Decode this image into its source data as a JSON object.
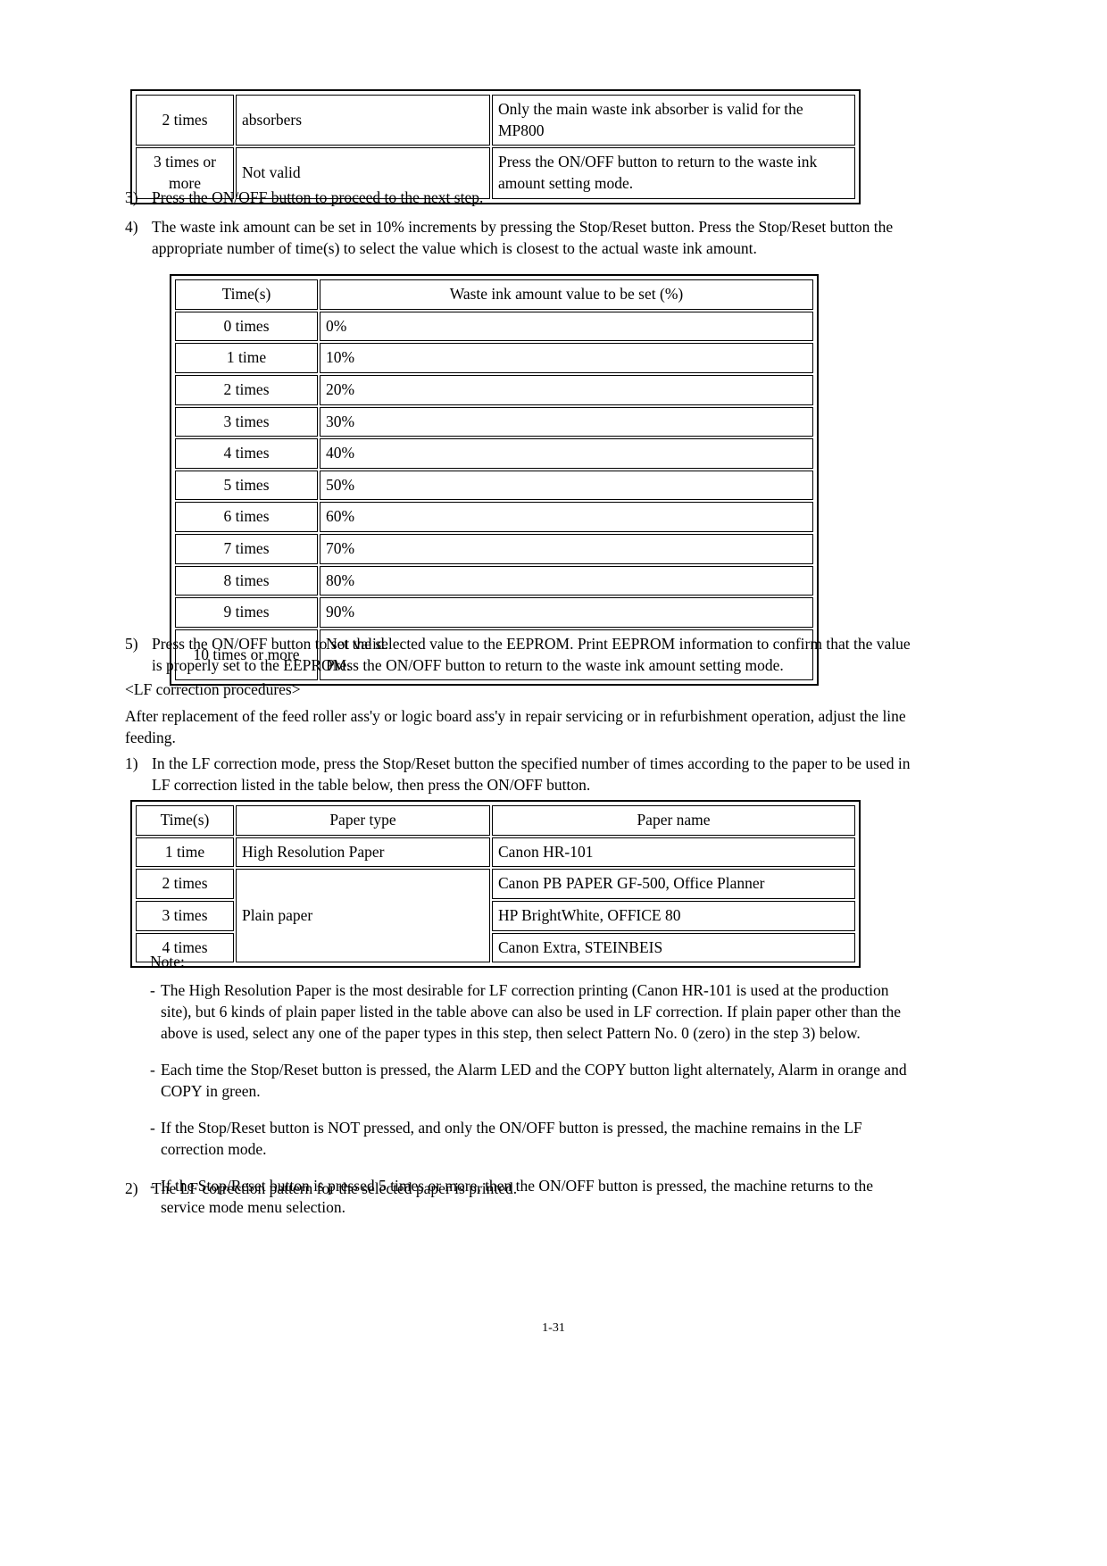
{
  "document": {
    "page_number": "1-31"
  },
  "top_table": {
    "rows": [
      {
        "times": "2 times",
        "validity": "absorbers",
        "description": "Only the main waste ink absorber is valid for the MP800"
      },
      {
        "times": "3 times or more",
        "validity": "Not valid",
        "description": "Press the ON/OFF button to return to the waste ink amount setting mode."
      }
    ]
  },
  "steps": {
    "step3": {
      "num": "3)",
      "text": "Press the ON/OFF button to proceed to the next step."
    },
    "step4": {
      "num": "4)",
      "text": "The waste ink amount can be set in 10% increments by pressing the Stop/Reset button. Press the Stop/Reset button the appropriate number of time(s) to select the value which is closest to the actual waste ink amount."
    },
    "step5": {
      "num": "5)",
      "text": "Press the ON/OFF button to set the selected value to the EEPROM. Print EEPROM information to confirm that the value is properly set to the EEPROM."
    }
  },
  "waste_ink_table": {
    "headers": [
      "Time(s)",
      "Waste ink amount value to be set (%)"
    ],
    "rows": [
      {
        "times": "0 times",
        "value": "0%"
      },
      {
        "times": "1 time",
        "value": "10%"
      },
      {
        "times": "2 times",
        "value": "20%"
      },
      {
        "times": "3 times",
        "value": "30%"
      },
      {
        "times": "4 times",
        "value": "40%"
      },
      {
        "times": "5 times",
        "value": "50%"
      },
      {
        "times": "6 times",
        "value": "60%"
      },
      {
        "times": "7 times",
        "value": "70%"
      },
      {
        "times": "8 times",
        "value": "80%"
      },
      {
        "times": "9 times",
        "value": "90%"
      }
    ],
    "last_row": {
      "times": "10 times or more",
      "line1": "Not valid.",
      "line2": "Press the ON/OFF button to return to the waste ink amount setting mode."
    }
  },
  "lf_section": {
    "heading": "<LF correction procedures>",
    "intro": "After replacement of the feed roller ass'y or logic board ass'y in repair servicing or in refurbishment operation, adjust the line feeding.",
    "step1": {
      "num": "1)",
      "text": "In the LF correction mode, press the Stop/Reset button the specified number of times according to the paper to be used in LF correction listed in the table below, then press the ON/OFF button."
    },
    "step2": {
      "num": "2)",
      "text": "The LF correction pattern for the selected paper is printed."
    }
  },
  "paper_table": {
    "headers": [
      "Time(s)",
      "Paper type",
      "Paper name"
    ],
    "rows": [
      {
        "times": "1 time",
        "paper_type": "High Resolution Paper",
        "paper_name": "Canon HR-101"
      },
      {
        "times": "2 times",
        "paper_type": "Plain paper",
        "paper_name": "Canon PB PAPER GF-500, Office Planner"
      },
      {
        "times": "3 times",
        "paper_type": "",
        "paper_name": "HP BrightWhite, OFFICE 80"
      },
      {
        "times": "4 times",
        "paper_type": "",
        "paper_name": "Canon Extra, STEINBEIS"
      }
    ]
  },
  "note": {
    "label": "Note:",
    "items": [
      "The High Resolution Paper is the most desirable for LF correction printing (Canon HR-101 is used at the production site), but 6 kinds of plain paper listed in the table above can also be used in LF correction. If plain paper other than the above is used, select any one of the paper types in this step, then select Pattern No. 0 (zero) in the step 3) below.",
      "Each time the Stop/Reset button is pressed, the Alarm LED and the COPY button light alternately, Alarm in orange and COPY in green.",
      "If the Stop/Reset button is NOT pressed, and only the ON/OFF button is pressed, the machine remains in the LF correction mode.",
      "If the Stop/Reset button is pressed 5 times or more, then the ON/OFF button is pressed, the machine returns to the service mode menu selection."
    ],
    "dash": "-"
  }
}
